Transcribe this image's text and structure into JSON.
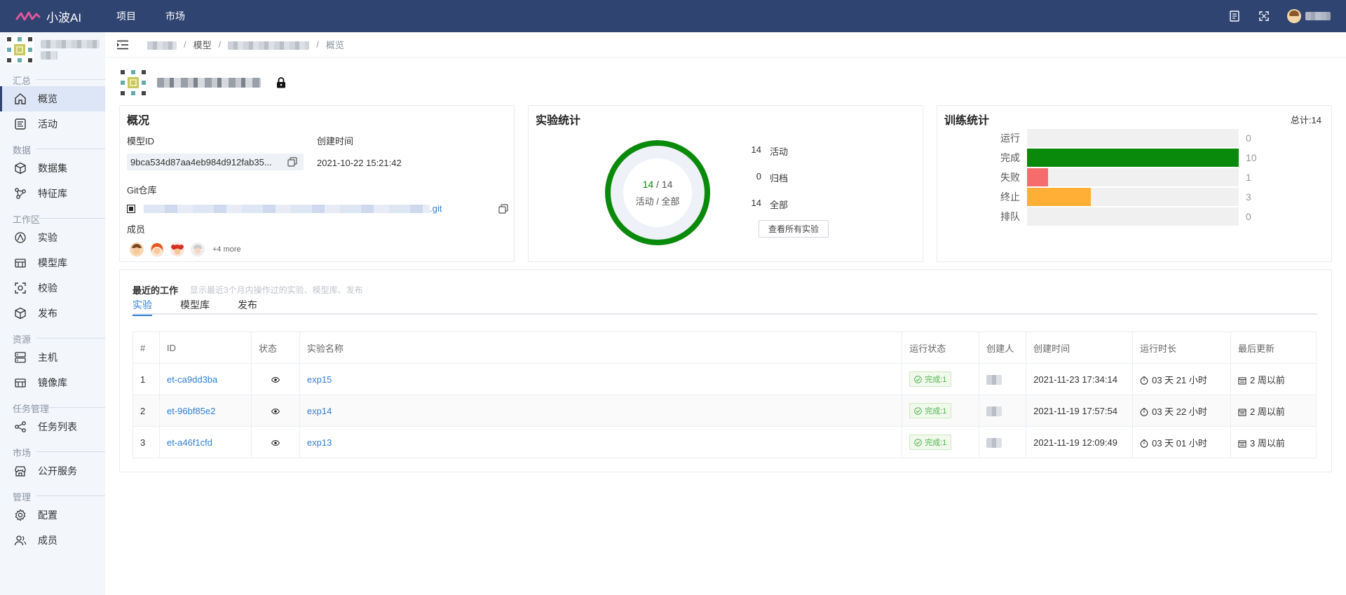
{
  "app": {
    "name": "小波AI"
  },
  "topnav": {
    "items": [
      "项目",
      "市场"
    ]
  },
  "sidebar": {
    "groups": [
      {
        "label": "汇总",
        "items": [
          "概览",
          "活动"
        ]
      },
      {
        "label": "数据",
        "items": [
          "数据集",
          "特征库"
        ]
      },
      {
        "label": "工作区",
        "items": [
          "实验",
          "模型库",
          "校验",
          "发布"
        ]
      },
      {
        "label": "资源",
        "items": [
          "主机",
          "镜像库"
        ]
      },
      {
        "label": "任务管理",
        "items": [
          "任务列表"
        ]
      },
      {
        "label": "市场",
        "items": [
          "公开服务"
        ]
      },
      {
        "label": "管理",
        "items": [
          "配置",
          "成员"
        ]
      }
    ],
    "active_item": "概览"
  },
  "breadcrumb": {
    "model": "模型",
    "current": "概览"
  },
  "overview": {
    "title": "概况",
    "model_id_label": "模型ID",
    "model_id": "9bca534d87aa4eb984d912fab35...",
    "created_label": "创建时间",
    "created": "2021-10-22 15:21:42",
    "git_label": "Git仓库",
    "git_suffix": ".git",
    "members_label": "成员",
    "members_more": "+4 more"
  },
  "exp_stats": {
    "title": "实验统计",
    "active": 14,
    "total": 14,
    "ring_active": "14",
    "ring_total": "14",
    "ring_caption": "活动 / 全部",
    "rows": [
      {
        "num": "14",
        "label": "活动"
      },
      {
        "num": "0",
        "label": "归档"
      },
      {
        "num": "14",
        "label": "全部"
      }
    ],
    "view_all": "查看所有实验",
    "ring_color": "#0a8a0a"
  },
  "train_stats": {
    "title": "训练统计",
    "total": "总计:14",
    "max": 10,
    "rows": [
      {
        "label": "运行",
        "value": 0,
        "color": "#f0f0f0"
      },
      {
        "label": "完成",
        "value": 10,
        "color": "#0a8a0a"
      },
      {
        "label": "失败",
        "value": 1,
        "color": "#f56c6c"
      },
      {
        "label": "终止",
        "value": 3,
        "color": "#ffaf36"
      },
      {
        "label": "排队",
        "value": 0,
        "color": "#f0f0f0"
      }
    ]
  },
  "recent": {
    "title": "最近的工作",
    "hint": "显示最近3个月内操作过的实验、模型库、发布",
    "tabs": [
      "实验",
      "模型库",
      "发布"
    ],
    "columns": [
      "#",
      "ID",
      "状态",
      "实验名称",
      "运行状态",
      "创建人",
      "创建时间",
      "运行时长",
      "最后更新"
    ],
    "rows": [
      {
        "idx": "1",
        "id": "et-ca9dd3ba",
        "name": "exp15",
        "status": "完成:1",
        "created": "2021-11-23 17:34:14",
        "duration": "03 天 21 小时",
        "updated": "2 周以前"
      },
      {
        "idx": "2",
        "id": "et-96bf85e2",
        "name": "exp14",
        "status": "完成:1",
        "created": "2021-11-19 17:57:54",
        "duration": "03 天 22 小时",
        "updated": "2 周以前"
      },
      {
        "idx": "3",
        "id": "et-a46f1cfd",
        "name": "exp13",
        "status": "完成:1",
        "created": "2021-11-19 12:09:49",
        "duration": "03 天 01 小时",
        "updated": "3 周以前"
      }
    ]
  }
}
